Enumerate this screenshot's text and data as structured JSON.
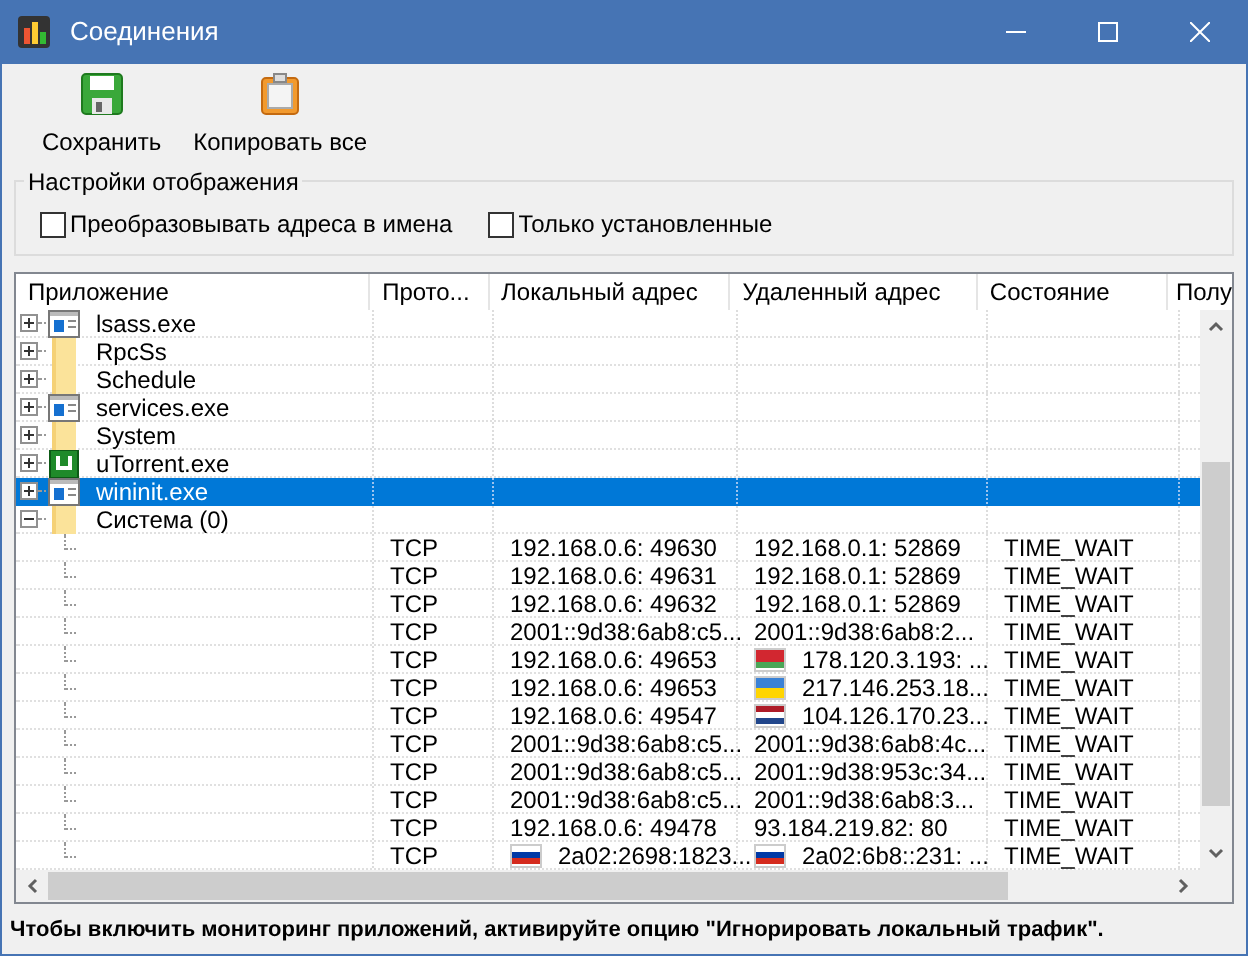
{
  "window": {
    "title": "Соединения"
  },
  "toolbar": [
    {
      "label": "Сохранить",
      "kind": "save"
    },
    {
      "label": "Копировать все",
      "kind": "copy"
    }
  ],
  "display_settings": {
    "title": "Настройки отображения",
    "options": [
      {
        "label": "Преобразовывать адреса в имена",
        "checked": false
      },
      {
        "label": "Только установленные",
        "checked": false
      }
    ]
  },
  "table": {
    "columns": [
      "Приложение",
      "Прото...",
      "Локальный адрес",
      "Удаленный адрес",
      "Состояние",
      "Полу"
    ],
    "apps": [
      {
        "name": "lsass.exe",
        "kind": "exe",
        "expanded": false,
        "selected": false
      },
      {
        "name": "RpcSs",
        "kind": "folder",
        "expanded": false,
        "selected": false
      },
      {
        "name": "Schedule",
        "kind": "folder",
        "expanded": false,
        "selected": false
      },
      {
        "name": "services.exe",
        "kind": "exe",
        "expanded": false,
        "selected": false
      },
      {
        "name": "System",
        "kind": "folder",
        "expanded": false,
        "selected": false
      },
      {
        "name": "uTorrent.exe",
        "kind": "torrent",
        "expanded": false,
        "selected": false
      },
      {
        "name": "wininit.exe",
        "kind": "exe",
        "expanded": false,
        "selected": true
      },
      {
        "name": "Система (0)",
        "kind": "folder",
        "expanded": true,
        "selected": false,
        "children": [
          {
            "protocol": "TCP",
            "local": "192.168.0.6: 49630",
            "remote": "192.168.0.1: 52869",
            "state": "TIME_WAIT",
            "selected": false
          },
          {
            "protocol": "TCP",
            "local": "192.168.0.6: 49631",
            "remote": "192.168.0.1: 52869",
            "state": "TIME_WAIT",
            "selected": false
          },
          {
            "protocol": "TCP",
            "local": "192.168.0.6: 49632",
            "remote": "192.168.0.1: 52869",
            "state": "TIME_WAIT",
            "selected": false
          },
          {
            "protocol": "TCP",
            "local": "2001::9d38:6ab8:c5...",
            "remote": "2001::9d38:6ab8:2...",
            "state": "TIME_WAIT",
            "selected": false
          },
          {
            "protocol": "TCP",
            "local": "192.168.0.6: 49653",
            "remote": "178.120.3.193: ...",
            "remote_flag": [
              {
                "color": "#d22730"
              },
              {
                "color": "#d22730"
              },
              {
                "color": "#4aa657"
              }
            ],
            "state": "TIME_WAIT",
            "selected": false
          },
          {
            "protocol": "TCP",
            "local": "192.168.0.6: 49653",
            "remote": "217.146.253.18...",
            "remote_flag": [
              {
                "color": "#3b82d6"
              },
              {
                "color": "#ffd500"
              }
            ],
            "state": "TIME_WAIT",
            "selected": false
          },
          {
            "protocol": "TCP",
            "local": "192.168.0.6: 49547",
            "remote": "104.126.170.23...",
            "remote_flag": [
              {
                "color": "#ae1c28"
              },
              {
                "color": "#ffffff"
              },
              {
                "color": "#21468b"
              }
            ],
            "state": "TIME_WAIT",
            "selected": false
          },
          {
            "protocol": "TCP",
            "local": "2001::9d38:6ab8:c5...",
            "remote": "2001::9d38:6ab8:4c...",
            "state": "TIME_WAIT",
            "selected": false
          },
          {
            "protocol": "TCP",
            "local": "2001::9d38:6ab8:c5...",
            "remote": "2001::9d38:953c:34...",
            "state": "TIME_WAIT",
            "selected": false
          },
          {
            "protocol": "TCP",
            "local": "2001::9d38:6ab8:c5...",
            "remote": "2001::9d38:6ab8:3...",
            "state": "TIME_WAIT",
            "selected": false
          },
          {
            "protocol": "TCP",
            "local": "192.168.0.6: 49478",
            "remote": "93.184.219.82: 80",
            "state": "TIME_WAIT",
            "selected": false
          },
          {
            "protocol": "TCP",
            "local": "2a02:2698:1823...",
            "local_flag": [
              {
                "color": "#ffffff"
              },
              {
                "color": "#0039a6"
              },
              {
                "color": "#d52b1e"
              }
            ],
            "remote": "2a02:6b8::231: ...",
            "remote_flag": [
              {
                "color": "#ffffff"
              },
              {
                "color": "#0039a6"
              },
              {
                "color": "#d52b1e"
              }
            ],
            "state": "TIME_WAIT",
            "selected": false
          }
        ]
      }
    ]
  },
  "status_bar": {
    "text": "Чтобы включить мониторинг приложений, активируйте опцию \"Игнорировать локальный трафик\"."
  }
}
